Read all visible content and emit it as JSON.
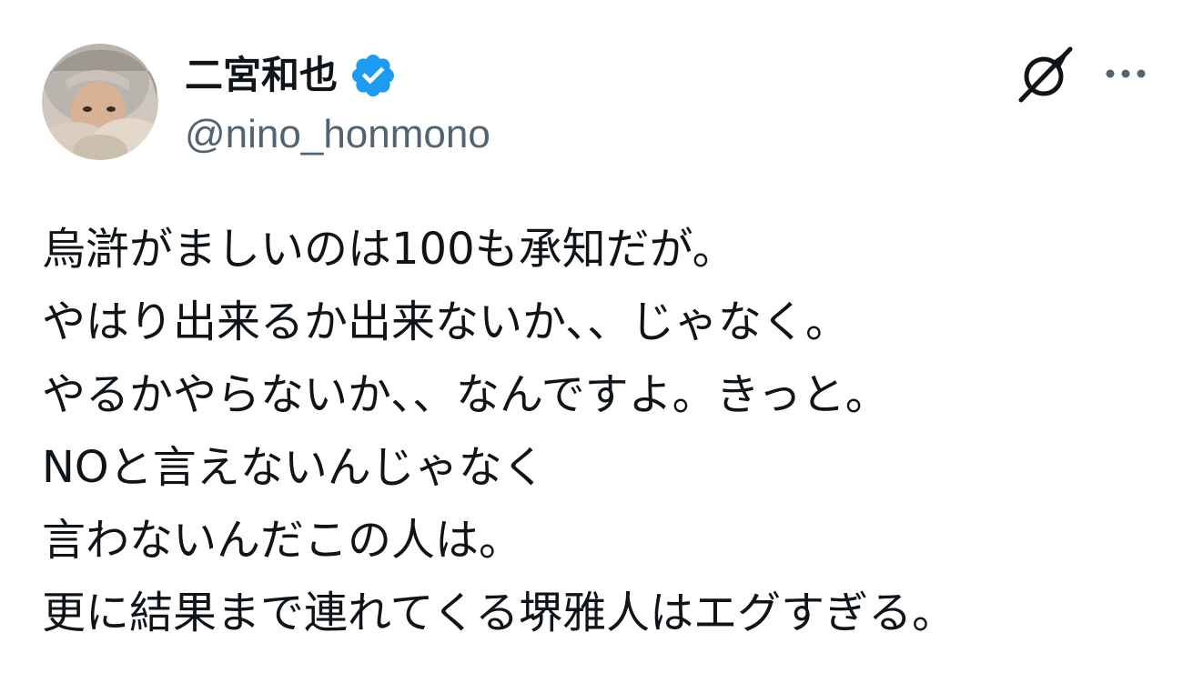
{
  "tweet": {
    "author": {
      "display_name": "二宮和也",
      "handle": "@nino_honmono",
      "verified": true,
      "avatar_icon": "avatar-photo"
    },
    "actions": {
      "grok_icon": "grok-icon",
      "more_icon": "more-icon"
    },
    "lines": [
      "烏滸がましいのは100も承知だが。",
      "やはり出来るか出来ないか、、じゃなく。",
      "やるかやらないか、、なんですよ。きっと。",
      "NOと言えないんじゃなく",
      "言わないんだこの人は。",
      "更に結果まで連れてくる堺雅人はエグすぎる。"
    ]
  },
  "colors": {
    "text": "#0f1419",
    "secondary_text": "#536471",
    "verified_badge": "#1d9bf0",
    "background": "#ffffff"
  }
}
